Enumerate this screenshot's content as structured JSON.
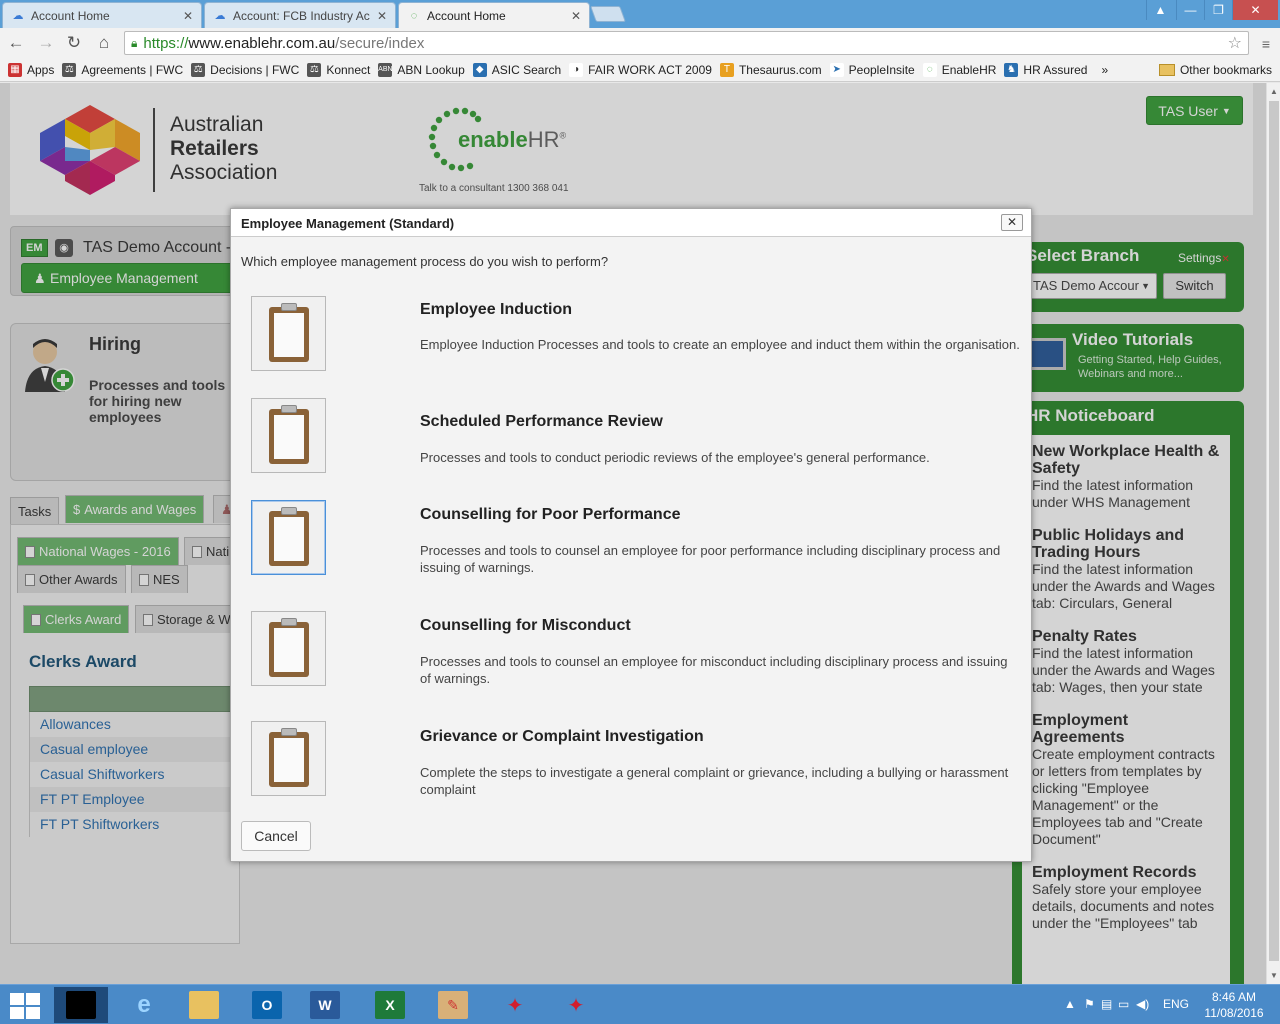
{
  "browser": {
    "tabs": [
      {
        "title": "Account Home",
        "icon": "salesforce-cloud-icon"
      },
      {
        "title": "Account: FCB Industry Ac",
        "icon": "salesforce-cloud-icon"
      },
      {
        "title": "Account Home",
        "icon": "enablehr-icon"
      }
    ],
    "url_scheme": "https://",
    "url_host": "www.enablehr.com.au",
    "url_path": "/secure/index",
    "bookmarks": [
      "Apps",
      "Agreements | FWC",
      "Decisions | FWC",
      "Konnect",
      "ABN Lookup",
      "ASIC Search",
      "FAIR WORK ACT 2009",
      "Thesaurus.com",
      "PeopleInsite",
      "EnableHR",
      "HR Assured"
    ],
    "bookmarks_overflow": "»",
    "other_bookmarks": "Other bookmarks"
  },
  "header": {
    "ara_line1": "Australian",
    "ara_line2": "Retailers",
    "ara_line3": "Association",
    "enable_word_a": "enable",
    "enable_word_b": "HR",
    "registered": "®",
    "tagline": "Talk to a consultant 1300 368 041",
    "user_button": "TAS User"
  },
  "account": {
    "badge": "EM",
    "name": "TAS Demo Account -",
    "em_button": "Employee Management"
  },
  "hiring": {
    "title": "Hiring",
    "desc": "Processes and tools for hiring new employees"
  },
  "tabs": {
    "tasks": "Tasks",
    "awards": "Awards and Wages",
    "national_wages": "National Wages - 2016",
    "nati": "Nati",
    "other_awards": "Other Awards",
    "nes": "NES",
    "clerks": "Clerks Award",
    "storage": "Storage & W"
  },
  "clerks": {
    "title": "Clerks Award",
    "rows": [
      "Allowances",
      "Casual employee",
      "Casual Shiftworkers",
      "FT PT Employee",
      "FT PT Shiftworkers"
    ]
  },
  "branch": {
    "title": "Select Branch",
    "settings": "Settings",
    "selected": "TAS Demo Accour",
    "switch": "Switch"
  },
  "video": {
    "title": "Video Tutorials",
    "sub": "Getting Started, Help Guides, Webinars and more..."
  },
  "notice": {
    "title": "HR Noticeboard",
    "items": [
      {
        "h": "New Workplace Health & Safety",
        "t": "Find the latest information under WHS Management"
      },
      {
        "h": "Public Holidays and Trading Hours",
        "t": "Find the latest information under the Awards and Wages tab: Circulars, General"
      },
      {
        "h": "Penalty Rates",
        "t": "Find the latest information under the Awards and Wages tab: Wages, then your state"
      },
      {
        "h": "Employment Agreements",
        "t": "Create employment contracts or letters from templates by clicking \"Employee Management\" or the Employees tab and \"Create Document\""
      },
      {
        "h": "Employment Records",
        "t": "Safely store your employee details, documents and notes under the \"Employees\" tab"
      }
    ]
  },
  "modal": {
    "title": "Employee Management (Standard)",
    "close": "✕",
    "question": "Which employee management process do you wish to perform?",
    "processes": [
      {
        "title": "Employee Induction",
        "desc": "Employee Induction Processes and tools to create an employee and induct them within the organisation."
      },
      {
        "title": "Scheduled Performance Review",
        "desc": "Processes and tools to conduct periodic reviews of the employee's general performance."
      },
      {
        "title": "Counselling for Poor Performance",
        "desc": "Processes and tools to counsel an employee for poor performance including disciplinary process and issuing of warnings."
      },
      {
        "title": "Counselling for Misconduct",
        "desc": "Processes and tools to counsel an employee for misconduct including disciplinary process and issuing of warnings."
      },
      {
        "title": "Grievance or Complaint Investigation",
        "desc": "Complete the steps to investigate a general complaint or grievance, including a bullying or harassment complaint"
      }
    ],
    "cancel": "Cancel"
  },
  "taskbar": {
    "lang": "ENG",
    "time": "8:46 AM",
    "date": "11/08/2016"
  },
  "colors": {
    "brand_green": "#3aa03a",
    "panel_green": "#2e8b2e",
    "link_blue": "#2a6fb0",
    "chrome_blue": "#5a9fd6"
  }
}
